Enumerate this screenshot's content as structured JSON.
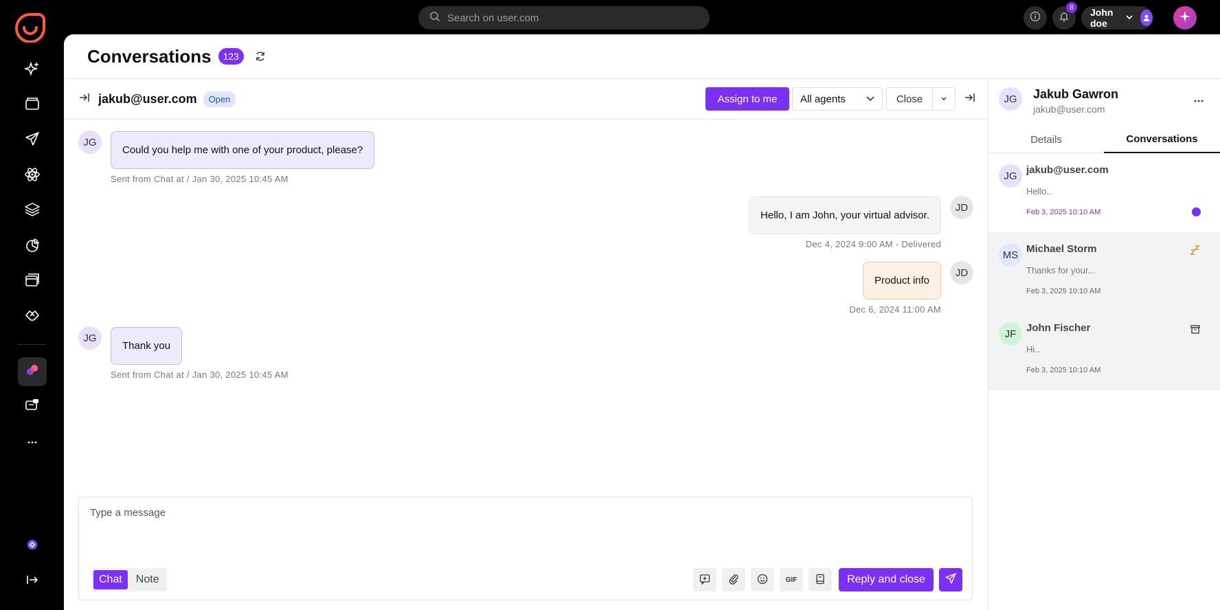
{
  "topbar": {
    "search_placeholder": "Search on user.com",
    "notifications_count": "8",
    "user_name": "John doe"
  },
  "sidebar": {
    "items": [
      {
        "name": "sparkles-icon"
      },
      {
        "name": "folder-icon"
      },
      {
        "name": "send-icon"
      },
      {
        "name": "atom-icon"
      },
      {
        "name": "layers-icon"
      },
      {
        "name": "analytics-icon"
      },
      {
        "name": "windows-icon"
      },
      {
        "name": "handshake-icon"
      },
      {
        "name": "conversations-icon",
        "active": true
      },
      {
        "name": "chat-bubbles-icon"
      },
      {
        "name": "more-icon"
      }
    ]
  },
  "page": {
    "title": "Conversations",
    "count": "123"
  },
  "conversation": {
    "email": "jakub@user.com",
    "status": "Open",
    "assign_label": "Assign to  me",
    "agents_label": "All agents",
    "close_label": "Close",
    "messages": [
      {
        "from": "JG",
        "text": "Could you help me with one of your product, please?",
        "meta": "Sent from Chat at / Jan 30, 2025 10:45 AM"
      },
      {
        "from": "JD",
        "text": "Hello, I am John, your virtual advisor.",
        "meta": "Dec 4, 2024 9:00 AM - Delivered"
      },
      {
        "from": "JD",
        "text": "Product info",
        "meta": "Dec 6, 2024 11:00 AM"
      },
      {
        "from": "JG",
        "text": "Thank you",
        "meta": "Sent from Chat at / Jan 30, 2025 10:45 AM"
      }
    ]
  },
  "composer": {
    "placeholder": "Type a message",
    "mode_chat": "Chat",
    "mode_note": "Note",
    "gif_label": "GIF",
    "reply_close_label": "Reply and close"
  },
  "contact": {
    "initials": "JG",
    "name": "Jakub Gawron",
    "email": "jakub@user.com",
    "tab_details": "Details",
    "tab_conversations": "Conversations"
  },
  "conv_list": [
    {
      "initials": "JG",
      "name": "jakub@user.com",
      "snippet": "Hello..",
      "time": "Feb 3, 2025 10:10 AM"
    },
    {
      "initials": "MS",
      "name": "Michael Storm",
      "snippet": "Thanks for your...",
      "time": "Feb 3, 2025 10:10 AM"
    },
    {
      "initials": "JF",
      "name": "John Fischer",
      "snippet": "Hi..",
      "time": "Feb 3, 2025 10:10 AM"
    }
  ],
  "colors": {
    "accent": "#7b2ff7",
    "brand_logo": "#ff5a3c"
  }
}
